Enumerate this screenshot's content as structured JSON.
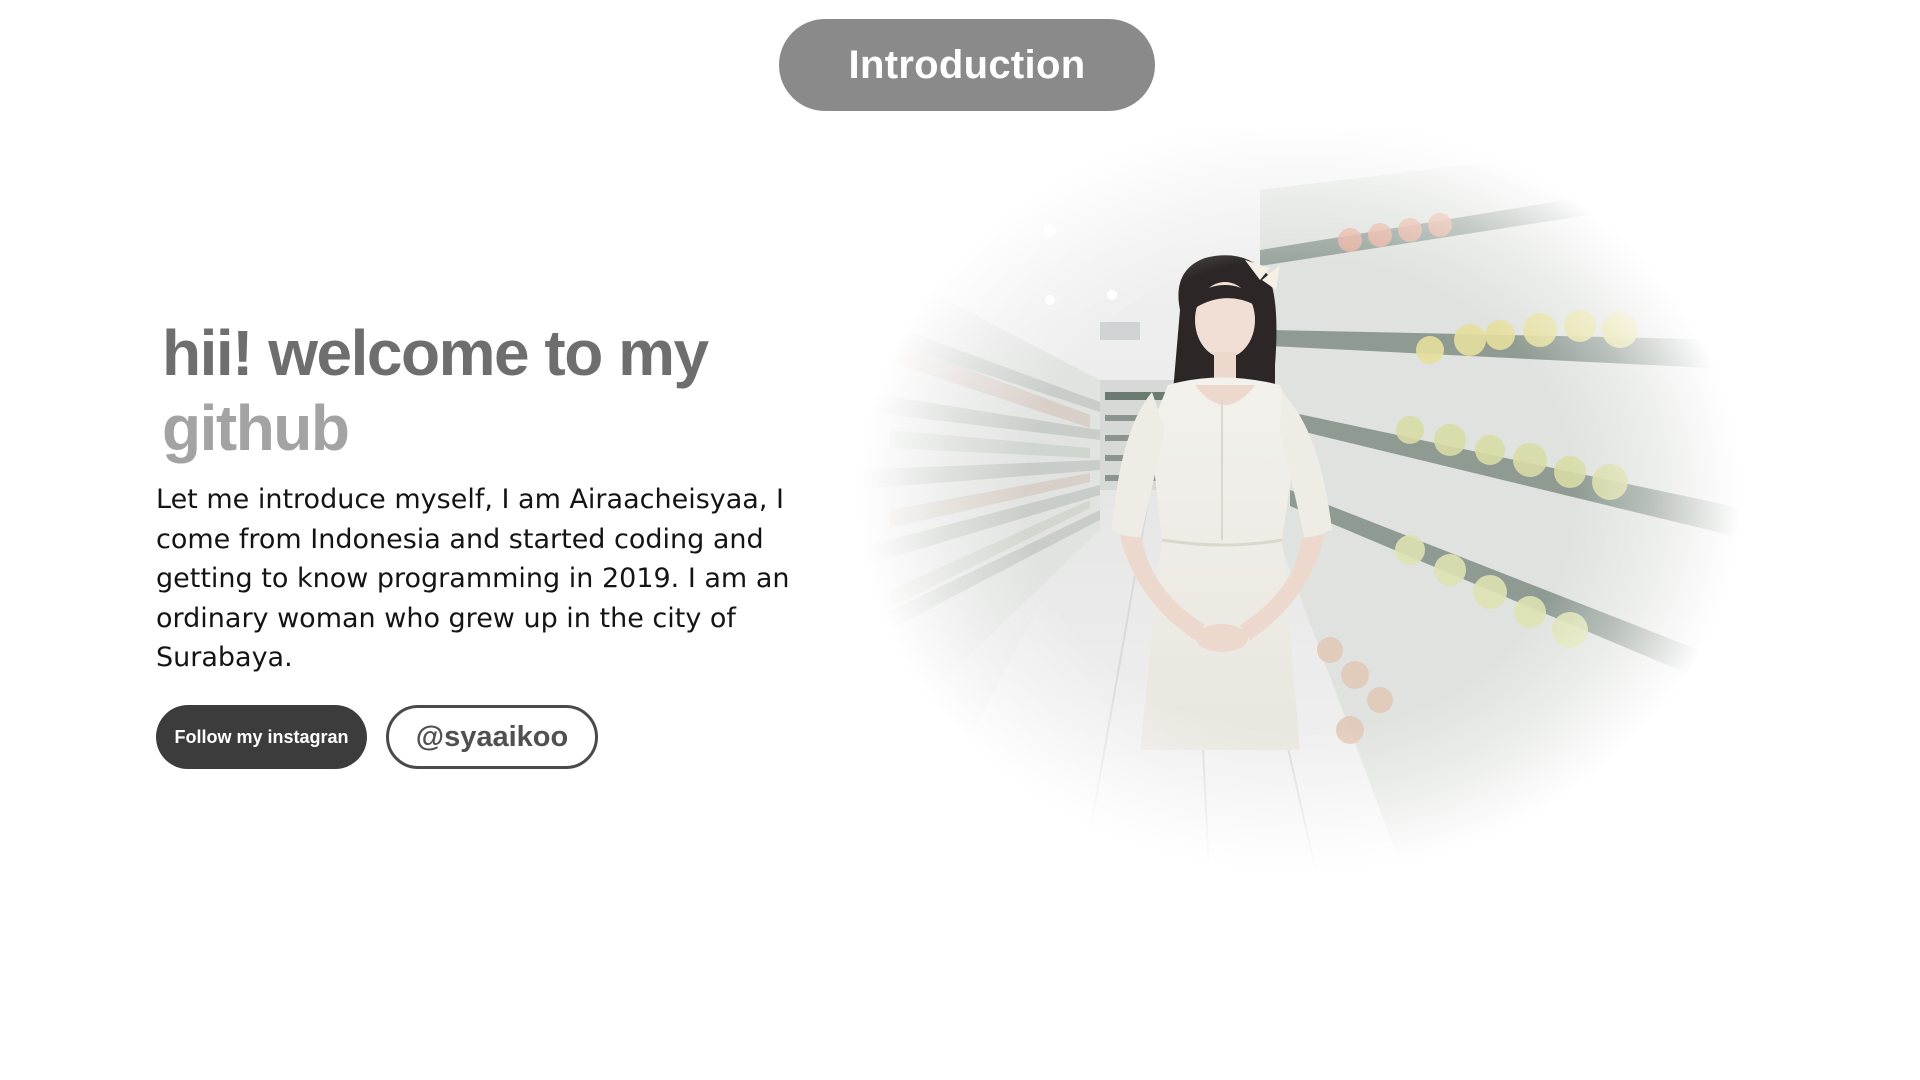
{
  "header": {
    "pill_label": "Introduction"
  },
  "hero": {
    "heading_line1": "hii! welcome to my",
    "heading_line2": "github",
    "intro_text": "Let me introduce myself, I am Airaacheisyaa, I come from Indonesia and started coding and getting to know programming in 2019. I am an ordinary woman who grew up in the city of Surabaya.",
    "follow_button_label": "Follow my instagran",
    "handle_button_label": "@syaaikoo"
  },
  "colors": {
    "pill_bg": "#8a8a8a",
    "heading_primary": "#6e6e6e",
    "heading_secondary": "#a3a3a3",
    "follow_bg": "#3c3c3c",
    "handle_border": "#4a4a4a"
  },
  "image": {
    "subject": "woman-in-white-dress-supermarket-aisle-photo"
  }
}
